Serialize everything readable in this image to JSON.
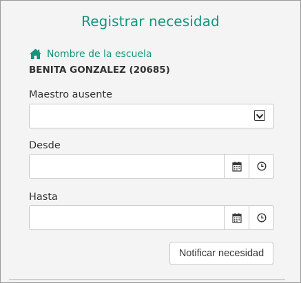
{
  "form": {
    "title": "Registrar necesidad",
    "school_label": "Nombre de la escuela",
    "school_name": "BENITA GONZALEZ (20685)",
    "absent_teacher": {
      "label": "Maestro ausente",
      "value": ""
    },
    "from": {
      "label": "Desde",
      "value": ""
    },
    "to": {
      "label": "Hasta",
      "value": ""
    },
    "submit_label": "Notificar necesidad"
  },
  "icons": {
    "school": "home-icon",
    "calendar": "calendar-icon",
    "clock": "clock-icon",
    "dropdown": "chevron-down-icon"
  },
  "colors": {
    "accent": "#14957e",
    "panel_background": "#f4f4f4"
  }
}
